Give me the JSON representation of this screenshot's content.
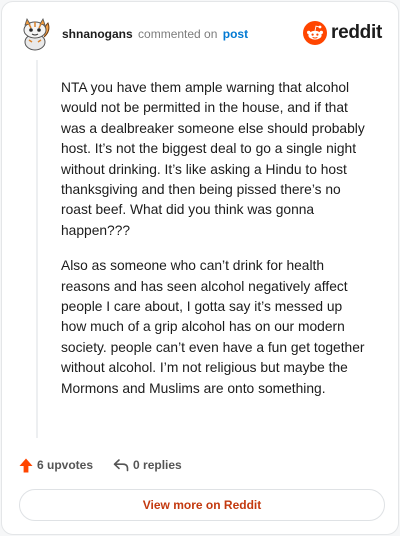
{
  "header": {
    "username": "shnanogans",
    "commented_on": "commented on",
    "post_link": "post",
    "brand": "reddit",
    "brand_color": "#ff4500"
  },
  "comment": {
    "paragraphs": [
      "NTA you have them ample warning that alcohol would not be permitted in the house, and if that was a dealbreaker someone else should probably host. It’s not the biggest deal to go a single night without drinking. It’s like asking a Hindu to host thanksgiving and then being pissed there’s no roast beef. What did you think was gonna happen???",
      "Also as someone who can’t drink for health reasons and has seen alcohol negatively affect people I care about, I gotta say it’s messed up how much of a grip alcohol has on our modern society. people can’t even have a fun get together without alcohol. I’m not religious but maybe the Mormons and Muslims are onto something."
    ]
  },
  "actions": {
    "upvotes": "6 upvotes",
    "replies": "0 replies",
    "upvote_icon": "upvote-arrow-icon",
    "reply_icon": "reply-arrow-icon"
  },
  "footer": {
    "view_more": "View more on Reddit",
    "view_more_color": "#c3390f"
  }
}
